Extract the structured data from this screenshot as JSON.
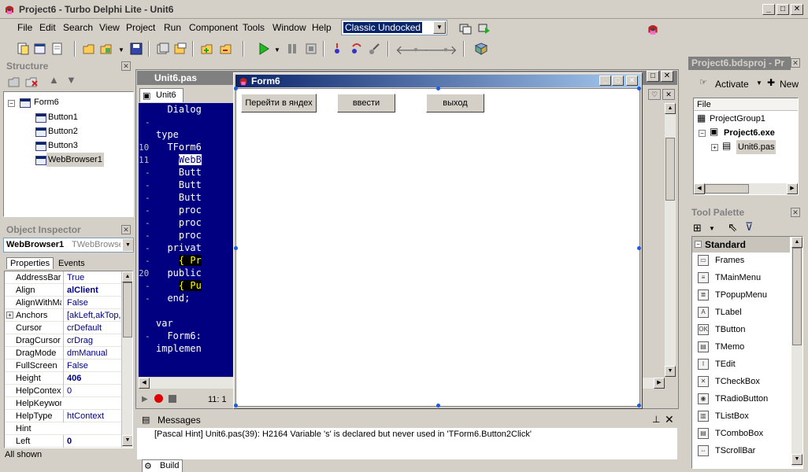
{
  "window": {
    "title": "Project6 - Turbo Delphi Lite - Unit6"
  },
  "menu": [
    "File",
    "Edit",
    "Search",
    "View",
    "Project",
    "Run",
    "Component",
    "Tools",
    "Window",
    "Help"
  ],
  "layout_combo": {
    "value": "Classic Undocked"
  },
  "structure": {
    "title": "Structure",
    "nodes": [
      "Form6",
      "Button1",
      "Button2",
      "Button3",
      "WebBrowser1"
    ]
  },
  "inspector": {
    "title": "Object Inspector",
    "selected_name": "WebBrowser1",
    "selected_type": "TWebBrowser",
    "tab_properties": "Properties",
    "tab_events": "Events",
    "rows": [
      {
        "name": "AddressBar",
        "value": "True"
      },
      {
        "name": "Align",
        "value": "alClient"
      },
      {
        "name": "AlignWithMa",
        "value": "False"
      },
      {
        "name": "Anchors",
        "value": "[akLeft,akTop,a"
      },
      {
        "name": "Cursor",
        "value": "crDefault"
      },
      {
        "name": "DragCursor",
        "value": "crDrag"
      },
      {
        "name": "DragMode",
        "value": "dmManual"
      },
      {
        "name": "FullScreen",
        "value": "False"
      },
      {
        "name": "Height",
        "value": "406"
      },
      {
        "name": "HelpContex",
        "value": "0"
      },
      {
        "name": "HelpKeywor",
        "value": ""
      },
      {
        "name": "HelpType",
        "value": "htContext"
      },
      {
        "name": "Hint",
        "value": ""
      },
      {
        "name": "Left",
        "value": "0"
      }
    ],
    "status": "All shown"
  },
  "editor": {
    "window_title": "Unit6.pas",
    "tab": "Unit6",
    "gutter": [
      " ",
      "-",
      " ",
      "10",
      "11",
      "-",
      "-",
      "-",
      "-",
      "-",
      "-",
      "-",
      "-",
      "20",
      "-",
      "-",
      " ",
      " ",
      "-",
      " "
    ],
    "lines": [
      "  Dialog",
      "",
      "type",
      "  TForm6",
      "    WebB",
      "    Butt",
      "    Butt",
      "    Butt",
      "    proc",
      "    proc",
      "    proc",
      "  privat",
      "    { Pr",
      "  public",
      "    { Pu",
      "  end;",
      "",
      "var",
      "  Form6:",
      "implemen"
    ],
    "cursor_pos": "11: 1"
  },
  "form": {
    "title": "Form6",
    "buttons": [
      "Перейти в яндех",
      "ввести",
      "выход"
    ]
  },
  "messages": {
    "title": "Messages",
    "text": "[Pascal Hint] Unit6.pas(39): H2164 Variable 's' is declared but never used in 'TForm6.Button2Click'",
    "tab_build": "Build"
  },
  "project": {
    "title": "Project6.bdsproj - Pr",
    "activate": "Activate",
    "new": "New",
    "header": "File",
    "items": [
      "ProjectGroup1",
      "Project6.exe",
      "Unit6.pas"
    ]
  },
  "palette": {
    "title": "Tool Palette",
    "category": "Standard",
    "items": [
      "Frames",
      "TMainMenu",
      "TPopupMenu",
      "TLabel",
      "TButton",
      "TMemo",
      "TEdit",
      "TCheckBox",
      "TRadioButton",
      "TListBox",
      "TComboBox",
      "TScrollBar"
    ]
  },
  "colors": {
    "editor_bg": "#000080",
    "caption_active": "#0a246a",
    "face": "#d4d0c8"
  }
}
